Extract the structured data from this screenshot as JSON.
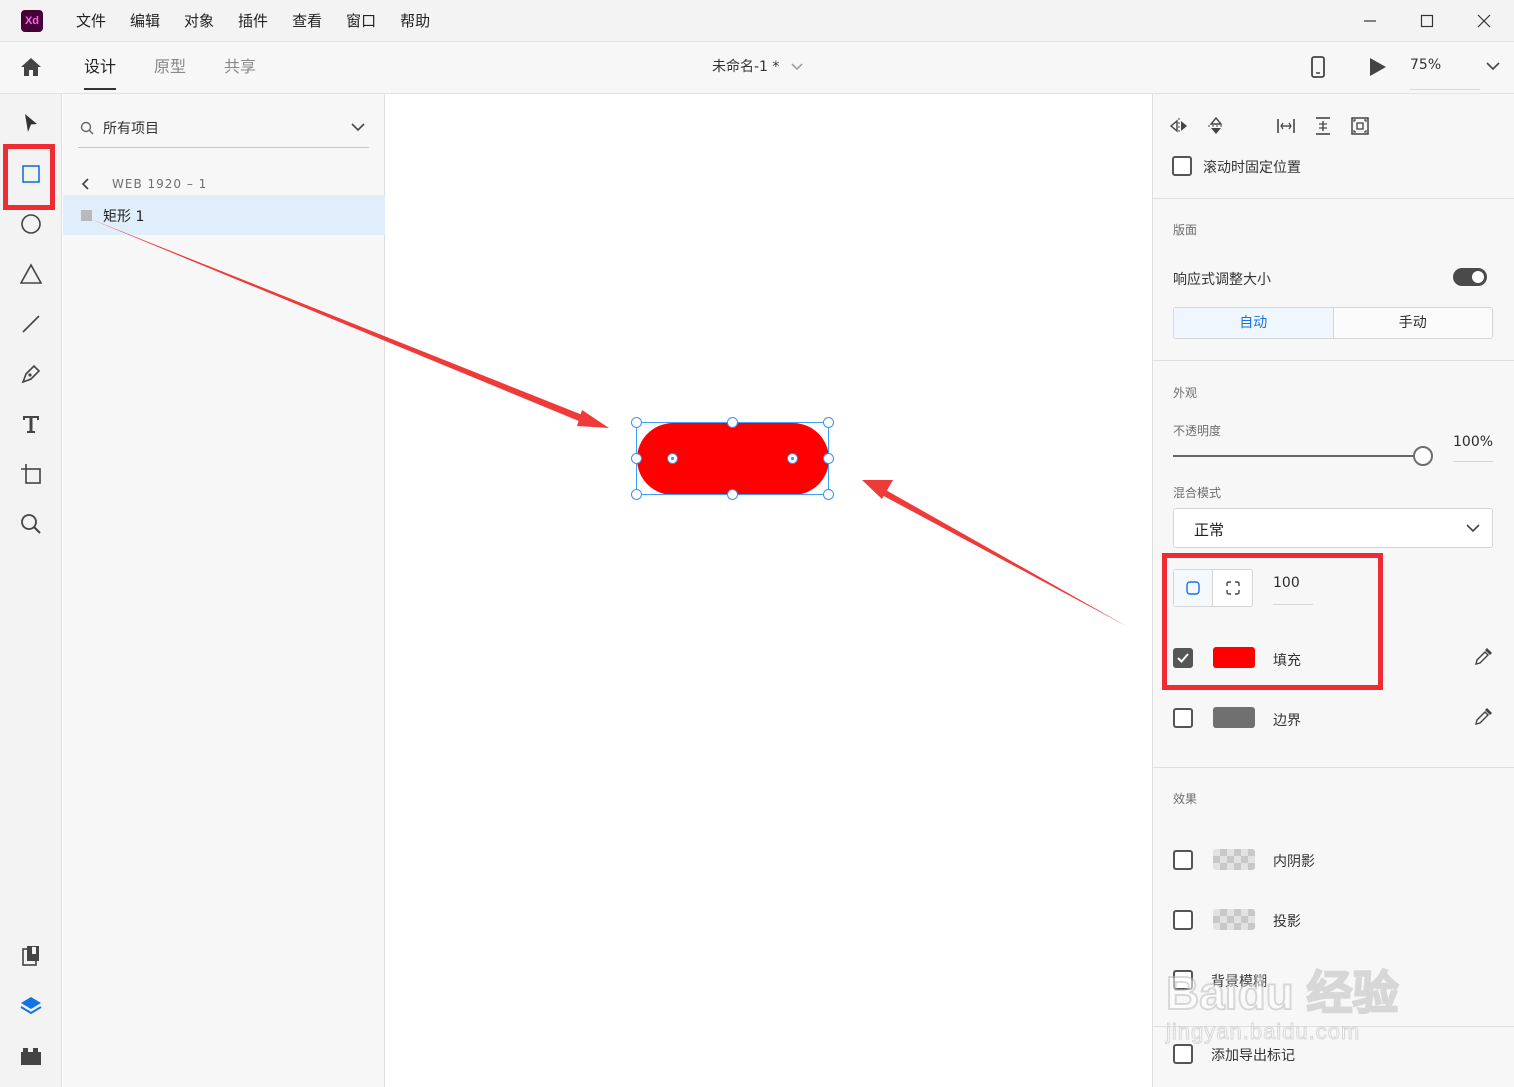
{
  "app": {
    "logo": "Xd",
    "menu": [
      "文件",
      "编辑",
      "对象",
      "插件",
      "查看",
      "窗口",
      "帮助"
    ],
    "window_controls": [
      "minimize-icon",
      "maximize-icon",
      "close-icon"
    ]
  },
  "toolbar": {
    "mode_tabs": [
      {
        "label": "设计",
        "active": true
      },
      {
        "label": "原型",
        "active": false
      },
      {
        "label": "共享",
        "active": false
      }
    ],
    "document_title": "未命名-1 *",
    "zoom": "75%"
  },
  "tools": [
    "select-tool-icon",
    "rectangle-tool-icon",
    "ellipse-tool-icon",
    "polygon-tool-icon",
    "line-tool-icon",
    "pen-tool-icon",
    "text-tool-icon",
    "artboard-tool-icon",
    "zoom-tool-icon"
  ],
  "bottom_tools": [
    "assets-icon",
    "layers-icon",
    "plugins-icon"
  ],
  "layers": {
    "filter_label": "所有项目",
    "artboard": "WEB 1920 – 1",
    "items": [
      {
        "name": "矩形 1",
        "selected": true
      }
    ]
  },
  "canvas": {
    "shape": {
      "type": "rounded-rectangle",
      "fill": "#ff0000",
      "corner_radius": 100
    }
  },
  "properties": {
    "fix_position_label": "滚动时固定位置",
    "fix_position_checked": false,
    "layout": {
      "title": "版面",
      "responsive_label": "响应式调整大小",
      "responsive_on": true,
      "modes": [
        {
          "label": "自动",
          "active": true
        },
        {
          "label": "手动",
          "active": false
        }
      ]
    },
    "appearance": {
      "title": "外观",
      "opacity_label": "不透明度",
      "opacity_value": "100%",
      "opacity": 1.0,
      "blend_label": "混合模式",
      "blend_value": "正常",
      "corner_radius": "100",
      "fill": {
        "label": "填充",
        "checked": true,
        "color": "#ff0000"
      },
      "border": {
        "label": "边界",
        "checked": false,
        "color": "#707070"
      }
    },
    "effects": {
      "title": "效果",
      "items": [
        {
          "label": "内阴影",
          "checked": false
        },
        {
          "label": "投影",
          "checked": false
        },
        {
          "label": "背景模糊",
          "checked": false
        }
      ]
    },
    "export_label": "添加导出标记"
  },
  "colors": {
    "accent": "#1473e6",
    "annotation": "#ef2b34",
    "selection": "#3d8ef5"
  },
  "watermark": {
    "brand": "Baidu 经验",
    "url": "jingyan.baidu.com"
  }
}
